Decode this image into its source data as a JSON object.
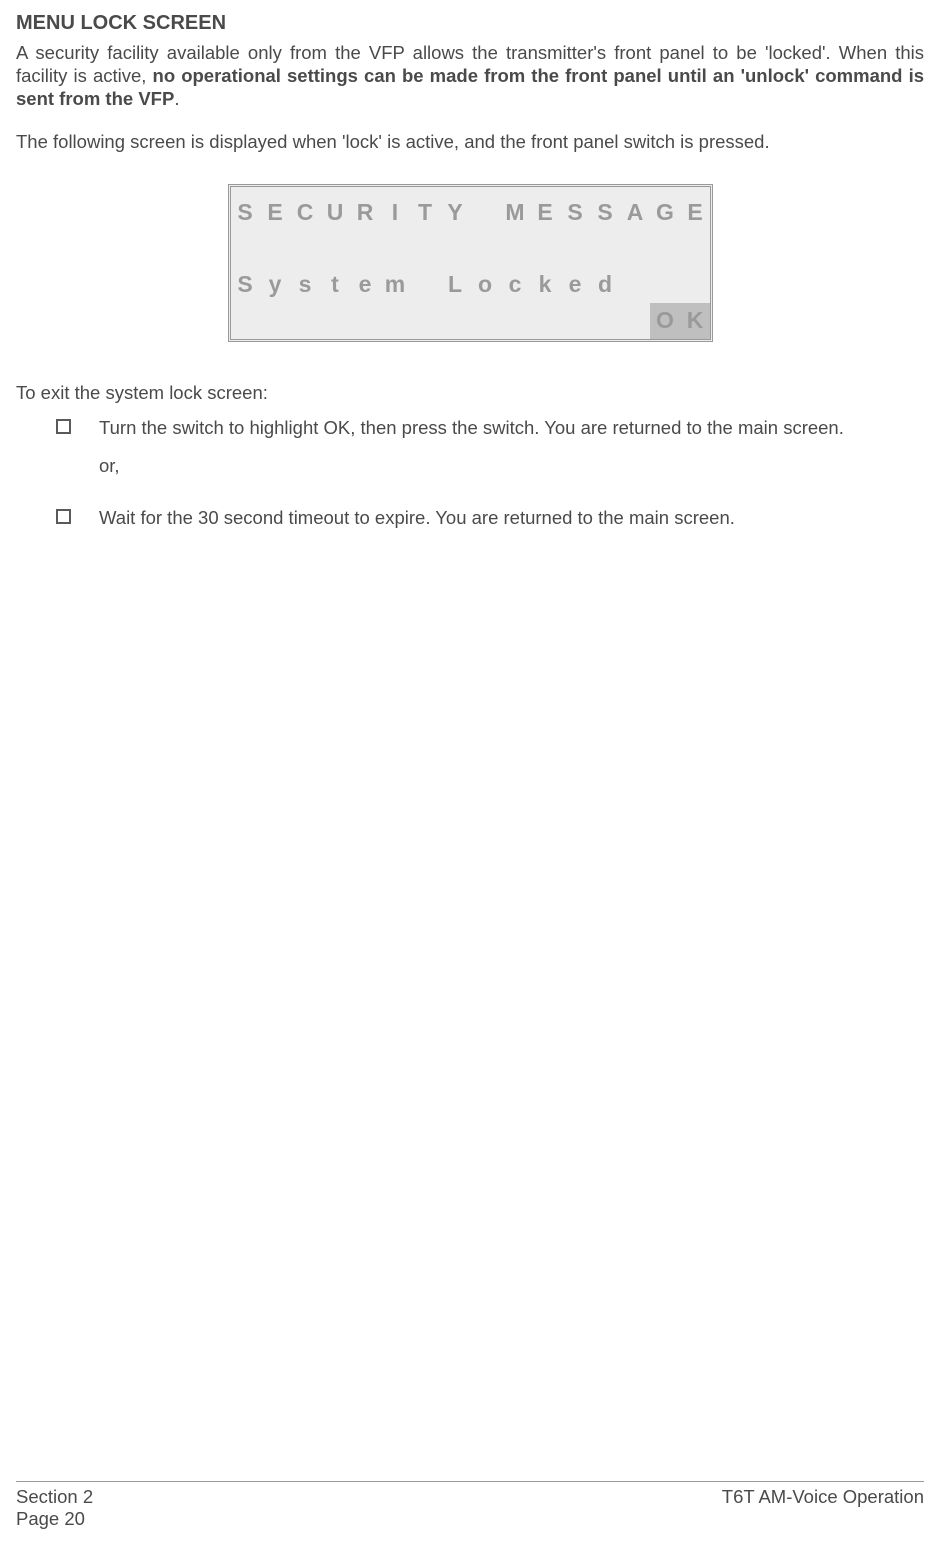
{
  "heading": "MENU LOCK SCREEN",
  "para1_a": "A security facility available only from the VFP allows the transmitter's front panel to be 'locked'. When this facility is active, ",
  "para1_b": "no operational settings can be made from the front panel until an 'unlock' command is sent from the VFP",
  "para1_c": ".",
  "para2": "The following screen is displayed when 'lock' is active, and the front panel switch is pressed.",
  "lcd": {
    "rows": [
      [
        "S",
        "E",
        "C",
        "U",
        "R",
        "I",
        "T",
        "Y",
        "",
        "M",
        "E",
        "S",
        "S",
        "A",
        "G",
        "E"
      ],
      [
        "",
        "",
        "",
        "",
        "",
        "",
        "",
        "",
        "",
        "",
        "",
        "",
        "",
        "",
        "",
        ""
      ],
      [
        "S",
        "y",
        "s",
        "t",
        "e",
        "m",
        "",
        "L",
        "o",
        "c",
        "k",
        "e",
        "d",
        "",
        "",
        ""
      ],
      [
        "",
        "",
        "",
        "",
        "",
        "",
        "",
        "",
        "",
        "",
        "",
        "",
        "",
        "",
        "O",
        "K"
      ]
    ],
    "highlight": {
      "row": 3,
      "cols": [
        14,
        15
      ]
    }
  },
  "instructions_intro": "To exit the system lock screen:",
  "items": [
    "Turn the switch to highlight OK, then press the switch. You are returned to the main screen.",
    "Wait for the 30 second timeout to expire. You are returned to the main screen."
  ],
  "or_label": "or,",
  "footer": {
    "section": "Section 2",
    "page": "Page 20",
    "right": "T6T AM-Voice Operation"
  }
}
